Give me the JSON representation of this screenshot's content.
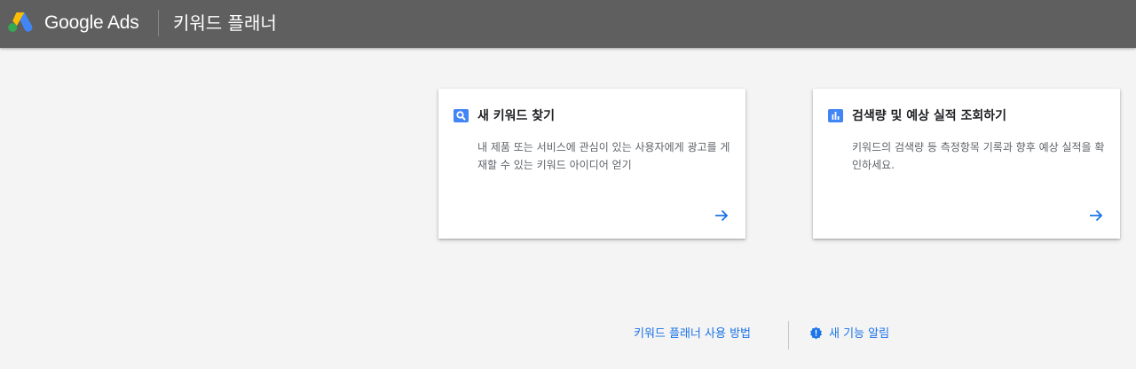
{
  "header": {
    "brand": "Google Ads",
    "product": "키워드 플래너"
  },
  "cards": [
    {
      "icon": "search-icon",
      "title": "새 키워드 찾기",
      "description": "내 제품 또는 서비스에 관심이 있는 사용자에게 광고를 게재할 수 있는 키워드 아이디어 얻기"
    },
    {
      "icon": "bar-chart-icon",
      "title": "검색량 및 예상 실적 조회하기",
      "description": "키워드의 검색량 등 측정항목 기록과 향후 예상 실적을 확인하세요."
    }
  ],
  "footer": {
    "how_to": "키워드 플래너 사용 방법",
    "new_features": "새 기능 알림"
  },
  "colors": {
    "header_bg": "#5f5f5f",
    "accent": "#1a73e8",
    "icon_blue": "#4285f4",
    "page_bg": "#f4f4f4"
  }
}
